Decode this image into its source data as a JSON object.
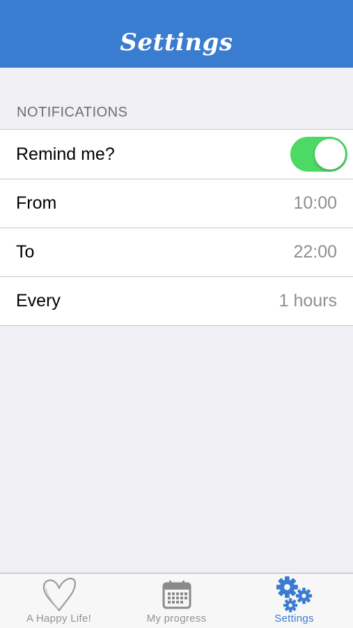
{
  "navbar": {
    "title": "Settings"
  },
  "notifications": {
    "header": "NOTIFICATIONS",
    "rows": [
      {
        "label": "Remind me?",
        "toggle_on": true
      },
      {
        "label": "From",
        "value": "10:00"
      },
      {
        "label": "To",
        "value": "22:00"
      },
      {
        "label": "Every",
        "value": "1 hours"
      }
    ]
  },
  "tabbar": {
    "tabs": [
      {
        "label": "A Happy Life!",
        "icon": "heart-icon",
        "active": false
      },
      {
        "label": "My progress",
        "icon": "calendar-icon",
        "active": false
      },
      {
        "label": "Settings",
        "icon": "gears-icon",
        "active": true
      }
    ]
  },
  "colors": {
    "accent": "#3a7ccf",
    "toggle_on": "#4cd964",
    "background": "#efeff4",
    "secondary_text": "#8e8e93"
  }
}
